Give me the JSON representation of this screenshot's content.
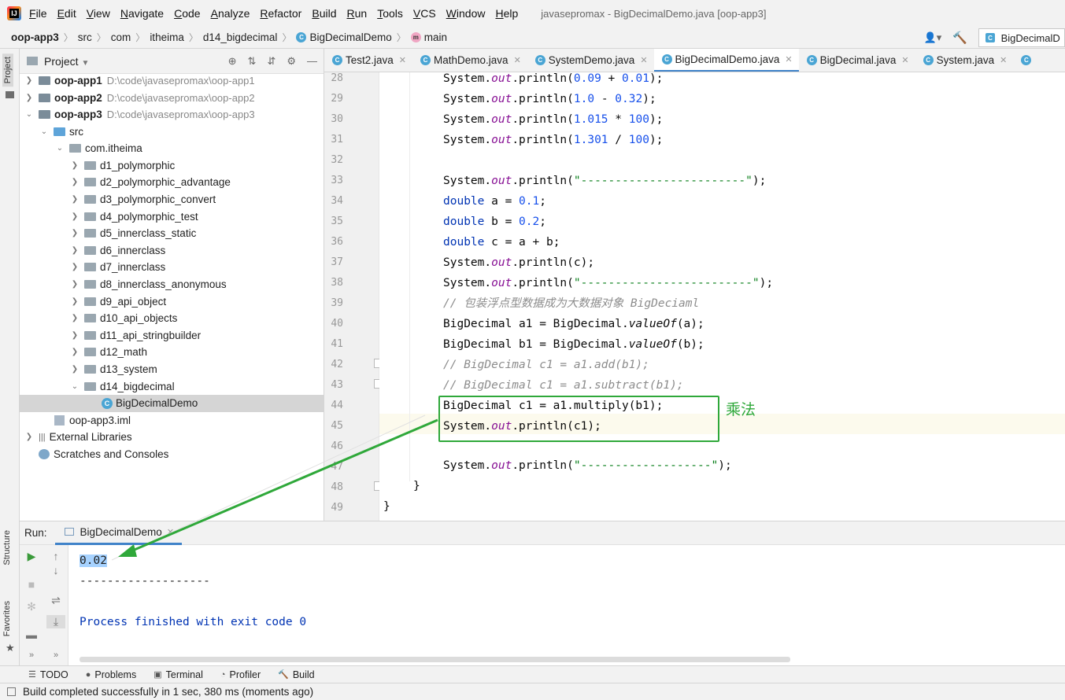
{
  "menubar": {
    "items": [
      "File",
      "Edit",
      "View",
      "Navigate",
      "Code",
      "Analyze",
      "Refactor",
      "Build",
      "Run",
      "Tools",
      "VCS",
      "Window",
      "Help"
    ],
    "title": "javasepromax - BigDecimalDemo.java [oop-app3]"
  },
  "navbar": {
    "crumbs": [
      "oop-app3",
      "src",
      "com",
      "itheima",
      "d14_bigdecimal",
      "BigDecimalDemo",
      "main"
    ],
    "run_config": "BigDecimalD"
  },
  "left_stripe": {
    "project": "Project",
    "structure": "Structure",
    "favorites": "Favorites"
  },
  "project_panel": {
    "title": "Project",
    "tree": [
      {
        "label": "oop-app1",
        "path": "D:\\code\\javasepromax\\oop-app1"
      },
      {
        "label": "oop-app2",
        "path": "D:\\code\\javasepromax\\oop-app2"
      },
      {
        "label": "oop-app3",
        "path": "D:\\code\\javasepromax\\oop-app3"
      },
      {
        "label": "src"
      },
      {
        "label": "com.itheima"
      },
      {
        "label": "d1_polymorphic"
      },
      {
        "label": "d2_polymorphic_advantage"
      },
      {
        "label": "d3_polymorphic_convert"
      },
      {
        "label": "d4_polymorphic_test"
      },
      {
        "label": "d5_innerclass_static"
      },
      {
        "label": "d6_innerclass"
      },
      {
        "label": "d7_innerclass"
      },
      {
        "label": "d8_innerclass_anonymous"
      },
      {
        "label": "d9_api_object"
      },
      {
        "label": "d10_api_objects"
      },
      {
        "label": "d11_api_stringbuilder"
      },
      {
        "label": "d12_math"
      },
      {
        "label": "d13_system"
      },
      {
        "label": "d14_bigdecimal"
      },
      {
        "label": "BigDecimalDemo"
      },
      {
        "label": "oop-app3.iml"
      },
      {
        "label": "External Libraries"
      },
      {
        "label": "Scratches and Consoles"
      }
    ]
  },
  "editor_tabs": [
    "Test2.java",
    "MathDemo.java",
    "SystemDemo.java",
    "BigDecimalDemo.java",
    "BigDecimal.java",
    "System.java"
  ],
  "line_numbers": [
    "28",
    "29",
    "30",
    "31",
    "32",
    "33",
    "34",
    "35",
    "36",
    "37",
    "38",
    "39",
    "40",
    "41",
    "42",
    "43",
    "44",
    "45",
    "46",
    "47",
    "48",
    "49"
  ],
  "code": {
    "l28": {
      "a": "System.",
      "b": "out",
      ".": "",
      "c": ".println(",
      "n1": "0.09",
      " op": " + ",
      "n2": "0.01",
      "end": ");"
    },
    "l29": {
      "n1": "1.0",
      "op": " - ",
      "n2": "0.32"
    },
    "l30": {
      "n1": "1.015",
      "op": " * ",
      "n2": "100"
    },
    "l31": {
      "n1": "1.301",
      "op": " / ",
      "n2": "100"
    },
    "sep1": "\"------------------------\"",
    "sep2": "\"-------------------------\"",
    "sep3": "\"-------------------\"",
    "l34": {
      "kw": "double",
      "rest": " a = ",
      "n": "0.1",
      "end": ";"
    },
    "l35": {
      "kw": "double",
      "rest": " b = ",
      "n": "0.2",
      "end": ";"
    },
    "l36": {
      "kw": "double",
      "rest": " c = a + b;"
    },
    "l37_arg": "c",
    "comment39": "// 包装浮点型数据成为大数据对象 BigDeciaml",
    "l40": "BigDecimal a1 = BigDecimal.",
    "l40b": "(a);",
    "l41": "BigDecimal b1 = BigDecimal.",
    "l41b": "(b);",
    "valueOf": "valueOf",
    "comment42": "// BigDecimal c1 = a1.add(b1);",
    "comment43": "// BigDecimal c1 = a1.subtract(b1);",
    "l44": "BigDecimal c1 = a1.multiply(b1);",
    "l45_arg": "c1",
    "system": "System.",
    "out": "out",
    "println": ".println(",
    "close": ");",
    "rbrace": "}",
    "annotation": "乘法"
  },
  "run_panel": {
    "label": "Run:",
    "tab": "BigDecimalDemo",
    "output_value": "0.02",
    "output_sep": "-------------------",
    "output_finish": "Process finished with exit code 0"
  },
  "bottom_tools": [
    "TODO",
    "Problems",
    "Terminal",
    "Profiler",
    "Build"
  ],
  "status": "Build completed successfully in 1 sec, 380 ms (moments ago)"
}
